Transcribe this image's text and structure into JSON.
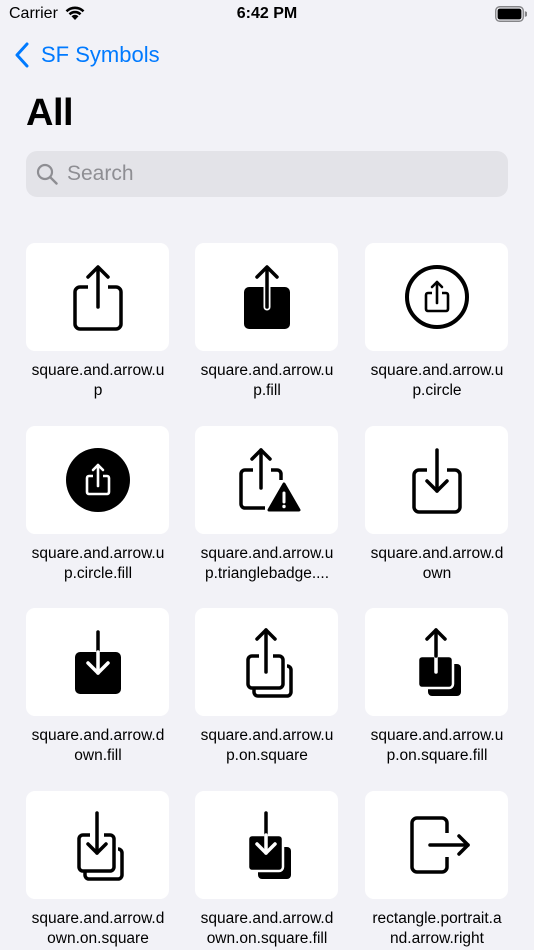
{
  "status": {
    "carrier": "Carrier",
    "time": "6:42 PM"
  },
  "nav": {
    "back_label": "SF Symbols"
  },
  "title": "All",
  "search": {
    "placeholder": "Search",
    "value": ""
  },
  "symbols": [
    {
      "name": "square.and.arrow.u\np",
      "icon": "square-and-arrow-up-icon"
    },
    {
      "name": "square.and.arrow.u\np.fill",
      "icon": "square-and-arrow-up-fill-icon"
    },
    {
      "name": "square.and.arrow.u\np.circle",
      "icon": "square-and-arrow-up-circle-icon"
    },
    {
      "name": "square.and.arrow.u\np.circle.fill",
      "icon": "square-and-arrow-up-circle-fill-icon"
    },
    {
      "name": "square.and.arrow.u\np.trianglebadge....",
      "icon": "square-and-arrow-up-trianglebadge-icon"
    },
    {
      "name": "square.and.arrow.d\nown",
      "icon": "square-and-arrow-down-icon"
    },
    {
      "name": "square.and.arrow.d\nown.fill",
      "icon": "square-and-arrow-down-fill-icon"
    },
    {
      "name": "square.and.arrow.u\np.on.square",
      "icon": "square-and-arrow-up-on-square-icon"
    },
    {
      "name": "square.and.arrow.u\np.on.square.fill",
      "icon": "square-and-arrow-up-on-square-fill-icon"
    },
    {
      "name": "square.and.arrow.d\nown.on.square",
      "icon": "square-and-arrow-down-on-square-icon"
    },
    {
      "name": "square.and.arrow.d\nown.on.square.fill",
      "icon": "square-and-arrow-down-on-square-fill-icon"
    },
    {
      "name": "rectangle.portrait.a\nnd.arrow.right",
      "icon": "rectangle-portrait-and-arrow-right-icon"
    }
  ]
}
